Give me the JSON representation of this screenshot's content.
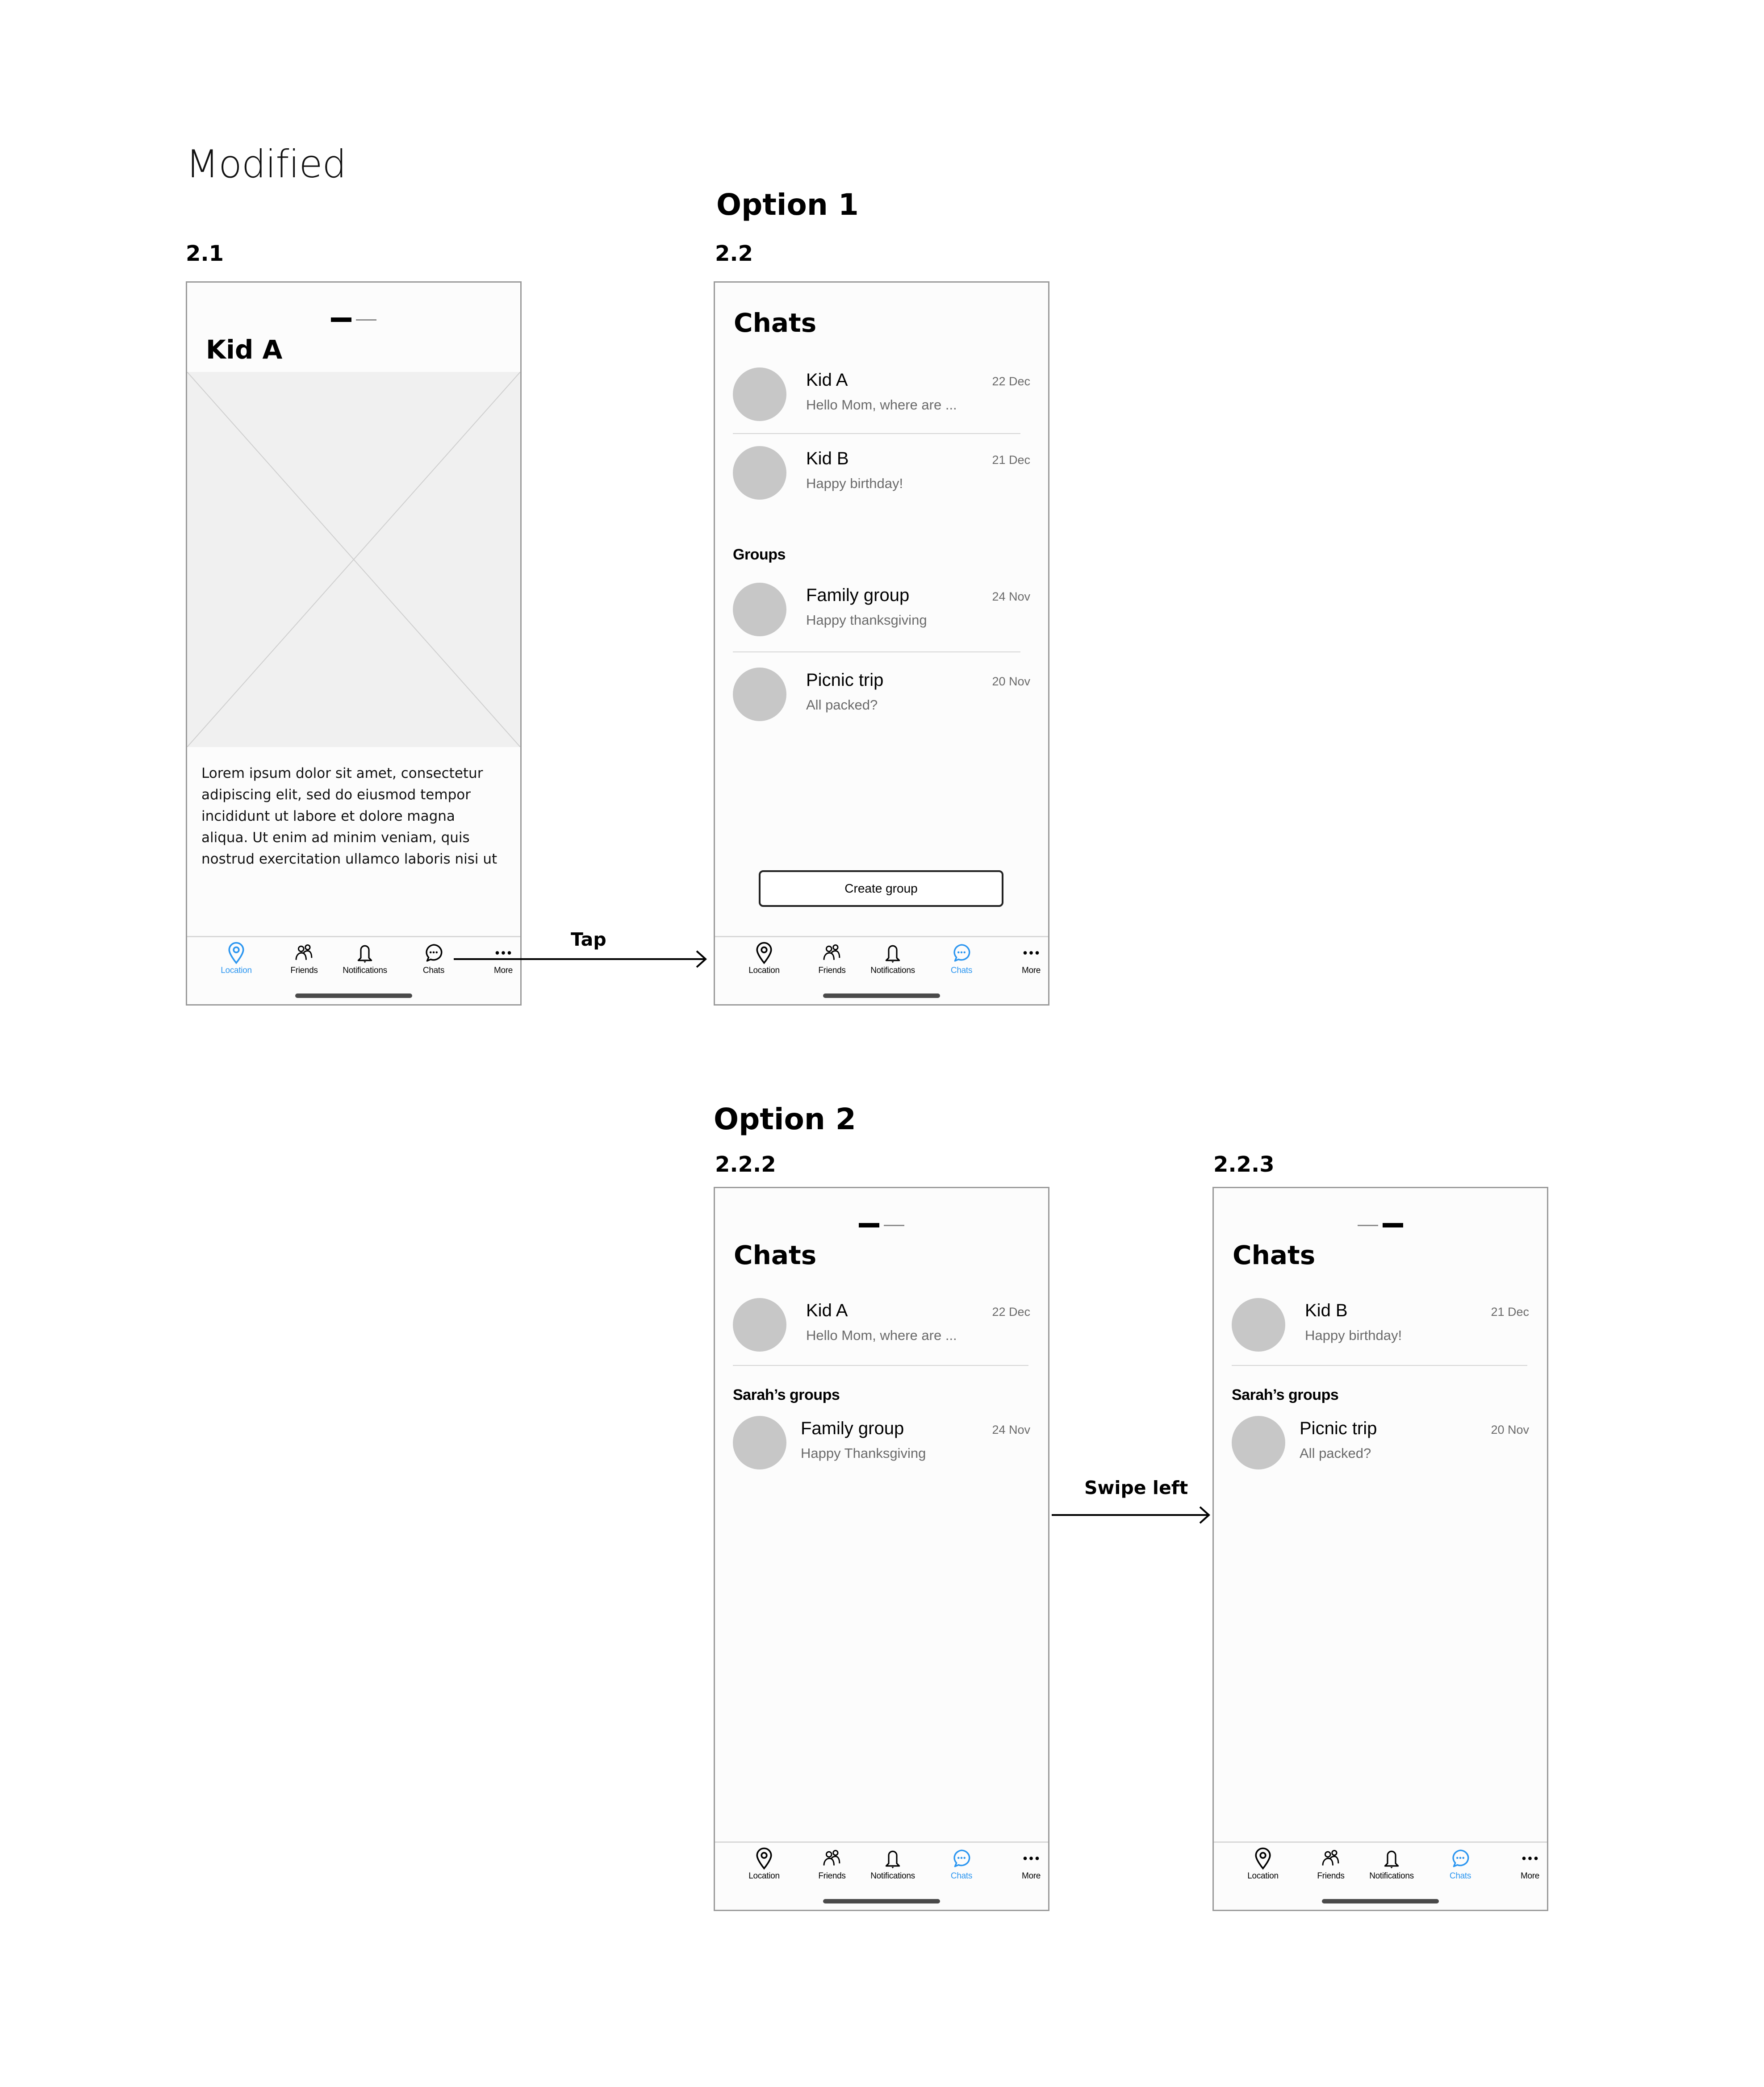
{
  "page": {
    "title": "Modified"
  },
  "options": {
    "option1_title": "Option 1",
    "option2_title": "Option 2"
  },
  "flows": {
    "tap_label": "Tap",
    "swipe_label": "Swipe left"
  },
  "colors": {
    "accent": "#2c96f0",
    "avatar": "#c7c7c7",
    "placeholder": "#f0f0f0"
  },
  "tabbar": {
    "items": [
      {
        "label": "Location",
        "icon": "map-pin-icon"
      },
      {
        "label": "Friends",
        "icon": "friends-icon"
      },
      {
        "label": "Notifications",
        "icon": "bell-icon"
      },
      {
        "label": "Chats",
        "icon": "chat-bubble-icon"
      },
      {
        "label": "More",
        "icon": "more-dots-icon"
      }
    ]
  },
  "screens": {
    "s21": {
      "id": "2.1",
      "heading": "Kid A",
      "pager": {
        "count": 2,
        "active": 1
      },
      "body": "Lorem ipsum dolor sit amet, consectetur adipiscing elit, sed do eiusmod tempor incididunt ut labore et dolore magna aliqua. Ut enim ad minim veniam, quis nostrud exercitation ullamco laboris nisi ut",
      "active_tab": "Location"
    },
    "s22": {
      "id": "2.2",
      "heading": "Chats",
      "chats": [
        {
          "name": "Kid A",
          "preview": "Hello Mom, where are ...",
          "date": "22 Dec"
        },
        {
          "name": "Kid B",
          "preview": "Happy birthday!",
          "date": "21 Dec"
        }
      ],
      "groups_label": "Groups",
      "groups": [
        {
          "name": "Family group",
          "preview": "Happy thanksgiving",
          "date": "24 Nov"
        },
        {
          "name": "Picnic trip",
          "preview": "All packed?",
          "date": "20 Nov"
        }
      ],
      "create_group_label": "Create group",
      "active_tab": "Chats"
    },
    "s222": {
      "id": "2.2.2",
      "heading": "Chats",
      "pager": {
        "count": 2,
        "active": 1
      },
      "chats": [
        {
          "name": "Kid A",
          "preview": "Hello Mom, where are ...",
          "date": "22 Dec"
        }
      ],
      "groups_label": "Sarah’s groups",
      "groups": [
        {
          "name": "Family group",
          "preview": "Happy Thanksgiving",
          "date": "24 Nov"
        }
      ],
      "active_tab": "Chats"
    },
    "s223": {
      "id": "2.2.3",
      "heading": "Chats",
      "pager": {
        "count": 2,
        "active": 2
      },
      "chats": [
        {
          "name": "Kid B",
          "preview": "Happy birthday!",
          "date": "21 Dec"
        }
      ],
      "groups_label": "Sarah’s groups",
      "groups": [
        {
          "name": "Picnic trip",
          "preview": "All packed?",
          "date": "20 Nov"
        }
      ],
      "active_tab": "Chats"
    }
  }
}
